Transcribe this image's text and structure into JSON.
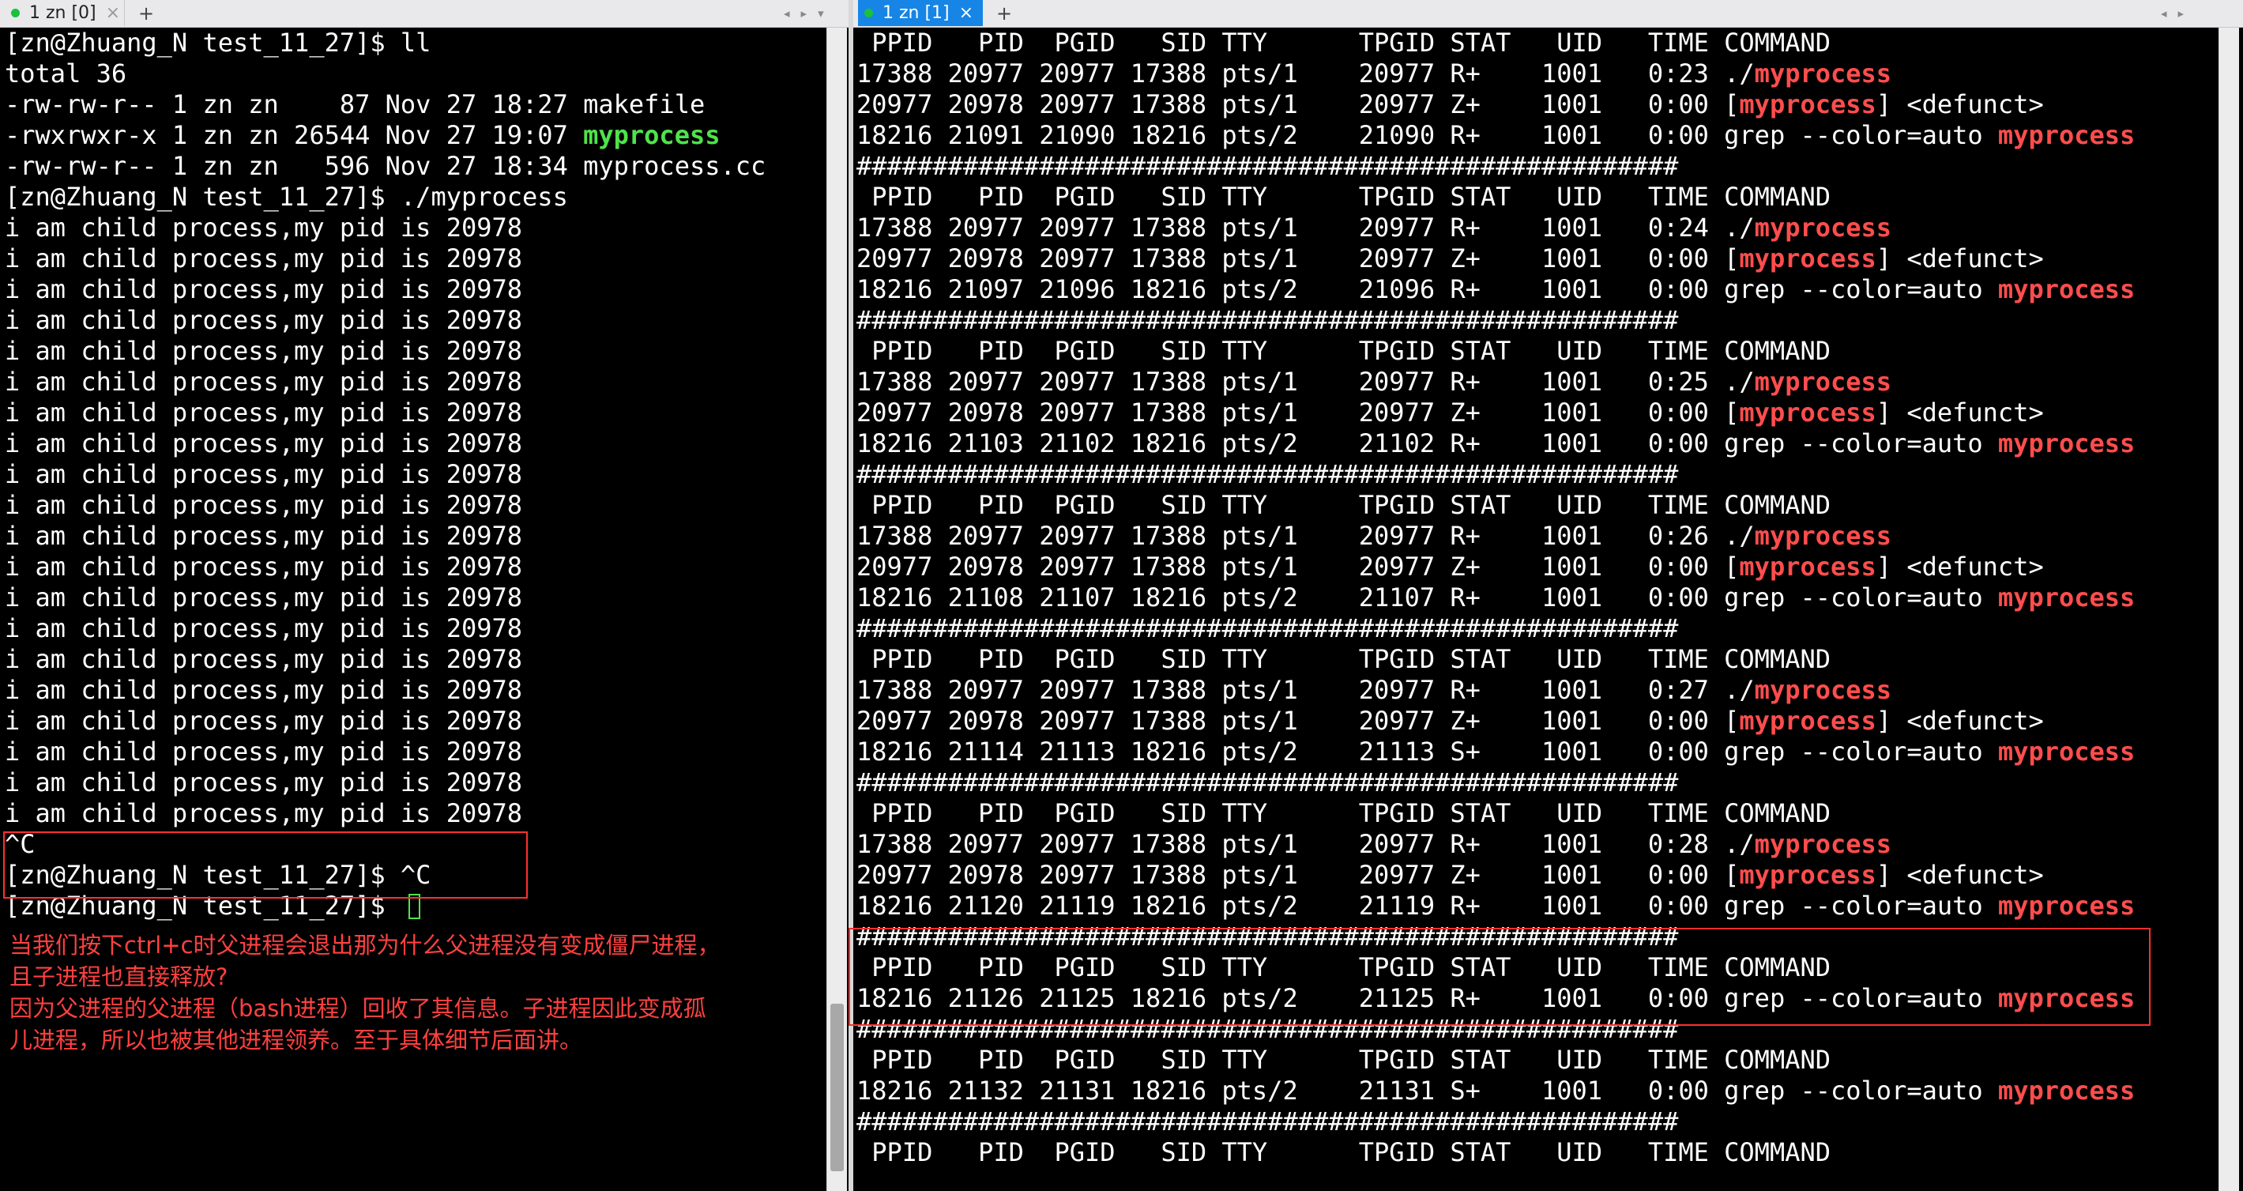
{
  "tabs": {
    "left": {
      "label": "1 zn [0]",
      "close": "×",
      "add": "+"
    },
    "right": {
      "label": "1 zn [1]",
      "close": "×",
      "add": "+"
    },
    "nav_icons": [
      "arrow-left-icon",
      "arrow-right-icon",
      "dropdown-arrow-icon"
    ]
  },
  "colors": {
    "background": "#000000",
    "text": "#ffffff",
    "executable": "#4fe34b",
    "grep_highlight": "#ff4d4d",
    "annotation": "#ff3030",
    "active_tab": "#1685e6",
    "status_dot": "#19c23a"
  },
  "left_terminal": {
    "lines": [
      [
        {
          "t": "[zn@Zhuang_N test_11_27]$ ll"
        }
      ],
      [
        {
          "t": "total 36"
        }
      ],
      [
        {
          "t": "-rw-rw-r-- 1 zn zn    87 Nov 27 18:27 makefile"
        }
      ],
      [
        {
          "t": "-rwxrwxr-x 1 zn zn 26544 Nov 27 19:07 "
        },
        {
          "t": "myprocess",
          "c": "exe"
        }
      ],
      [
        {
          "t": "-rw-rw-r-- 1 zn zn   596 Nov 27 18:34 myprocess.cc"
        }
      ],
      [
        {
          "t": "[zn@Zhuang_N test_11_27]$ ./myprocess"
        }
      ],
      [
        {
          "t": "i am child process,my pid is 20978"
        }
      ],
      [
        {
          "t": "i am child process,my pid is 20978"
        }
      ],
      [
        {
          "t": "i am child process,my pid is 20978"
        }
      ],
      [
        {
          "t": "i am child process,my pid is 20978"
        }
      ],
      [
        {
          "t": "i am child process,my pid is 20978"
        }
      ],
      [
        {
          "t": "i am child process,my pid is 20978"
        }
      ],
      [
        {
          "t": "i am child process,my pid is 20978"
        }
      ],
      [
        {
          "t": "i am child process,my pid is 20978"
        }
      ],
      [
        {
          "t": "i am child process,my pid is 20978"
        }
      ],
      [
        {
          "t": "i am child process,my pid is 20978"
        }
      ],
      [
        {
          "t": "i am child process,my pid is 20978"
        }
      ],
      [
        {
          "t": "i am child process,my pid is 20978"
        }
      ],
      [
        {
          "t": "i am child process,my pid is 20978"
        }
      ],
      [
        {
          "t": "i am child process,my pid is 20978"
        }
      ],
      [
        {
          "t": "i am child process,my pid is 20978"
        }
      ],
      [
        {
          "t": "i am child process,my pid is 20978"
        }
      ],
      [
        {
          "t": "i am child process,my pid is 20978"
        }
      ],
      [
        {
          "t": "i am child process,my pid is 20978"
        }
      ],
      [
        {
          "t": "i am child process,my pid is 20978"
        }
      ],
      [
        {
          "t": "i am child process,my pid is 20978"
        }
      ],
      [
        {
          "t": "^C"
        }
      ],
      [
        {
          "t": "[zn@Zhuang_N test_11_27]$ ^C"
        }
      ],
      [
        {
          "t": "[zn@Zhuang_N test_11_27]$ "
        },
        {
          "cursor": true
        }
      ]
    ],
    "note": [
      "当我们按下ctrl+c时父进程会退出那为什么父进程没有变成僵尸进程，",
      "且子进程也直接释放?",
      "因为父进程的父进程（bash进程）回收了其信息。子进程因此变成孤",
      "儿进程，所以也被其他进程领养。至于具体细节后面讲。"
    ]
  },
  "right_terminal": {
    "lines": [
      [
        {
          "t": " PPID   PID  PGID   SID TTY      TPGID STAT   UID   TIME COMMAND"
        }
      ],
      [
        {
          "t": "17388 20977 20977 17388 pts/1    20977 R+    1001   0:23 ./"
        },
        {
          "t": "myprocess",
          "c": "hl"
        }
      ],
      [
        {
          "t": "20977 20978 20977 17388 pts/1    20977 Z+    1001   0:00 ["
        },
        {
          "t": "myprocess",
          "c": "hl"
        },
        {
          "t": "] <defunct>"
        }
      ],
      [
        {
          "t": "18216 21091 21090 18216 pts/2    21090 R+    1001   0:00 grep --color=auto "
        },
        {
          "t": "myprocess",
          "c": "hl"
        }
      ],
      [
        {
          "t": "######################################################"
        }
      ],
      [
        {
          "t": " PPID   PID  PGID   SID TTY      TPGID STAT   UID   TIME COMMAND"
        }
      ],
      [
        {
          "t": "17388 20977 20977 17388 pts/1    20977 R+    1001   0:24 ./"
        },
        {
          "t": "myprocess",
          "c": "hl"
        }
      ],
      [
        {
          "t": "20977 20978 20977 17388 pts/1    20977 Z+    1001   0:00 ["
        },
        {
          "t": "myprocess",
          "c": "hl"
        },
        {
          "t": "] <defunct>"
        }
      ],
      [
        {
          "t": "18216 21097 21096 18216 pts/2    21096 R+    1001   0:00 grep --color=auto "
        },
        {
          "t": "myprocess",
          "c": "hl"
        }
      ],
      [
        {
          "t": "######################################################"
        }
      ],
      [
        {
          "t": " PPID   PID  PGID   SID TTY      TPGID STAT   UID   TIME COMMAND"
        }
      ],
      [
        {
          "t": "17388 20977 20977 17388 pts/1    20977 R+    1001   0:25 ./"
        },
        {
          "t": "myprocess",
          "c": "hl"
        }
      ],
      [
        {
          "t": "20977 20978 20977 17388 pts/1    20977 Z+    1001   0:00 ["
        },
        {
          "t": "myprocess",
          "c": "hl"
        },
        {
          "t": "] <defunct>"
        }
      ],
      [
        {
          "t": "18216 21103 21102 18216 pts/2    21102 R+    1001   0:00 grep --color=auto "
        },
        {
          "t": "myprocess",
          "c": "hl"
        }
      ],
      [
        {
          "t": "######################################################"
        }
      ],
      [
        {
          "t": " PPID   PID  PGID   SID TTY      TPGID STAT   UID   TIME COMMAND"
        }
      ],
      [
        {
          "t": "17388 20977 20977 17388 pts/1    20977 R+    1001   0:26 ./"
        },
        {
          "t": "myprocess",
          "c": "hl"
        }
      ],
      [
        {
          "t": "20977 20978 20977 17388 pts/1    20977 Z+    1001   0:00 ["
        },
        {
          "t": "myprocess",
          "c": "hl"
        },
        {
          "t": "] <defunct>"
        }
      ],
      [
        {
          "t": "18216 21108 21107 18216 pts/2    21107 R+    1001   0:00 grep --color=auto "
        },
        {
          "t": "myprocess",
          "c": "hl"
        }
      ],
      [
        {
          "t": "######################################################"
        }
      ],
      [
        {
          "t": " PPID   PID  PGID   SID TTY      TPGID STAT   UID   TIME COMMAND"
        }
      ],
      [
        {
          "t": "17388 20977 20977 17388 pts/1    20977 R+    1001   0:27 ./"
        },
        {
          "t": "myprocess",
          "c": "hl"
        }
      ],
      [
        {
          "t": "20977 20978 20977 17388 pts/1    20977 Z+    1001   0:00 ["
        },
        {
          "t": "myprocess",
          "c": "hl"
        },
        {
          "t": "] <defunct>"
        }
      ],
      [
        {
          "t": "18216 21114 21113 18216 pts/2    21113 S+    1001   0:00 grep --color=auto "
        },
        {
          "t": "myprocess",
          "c": "hl"
        }
      ],
      [
        {
          "t": "######################################################"
        }
      ],
      [
        {
          "t": " PPID   PID  PGID   SID TTY      TPGID STAT   UID   TIME COMMAND"
        }
      ],
      [
        {
          "t": "17388 20977 20977 17388 pts/1    20977 R+    1001   0:28 ./"
        },
        {
          "t": "myprocess",
          "c": "hl"
        }
      ],
      [
        {
          "t": "20977 20978 20977 17388 pts/1    20977 Z+    1001   0:00 ["
        },
        {
          "t": "myprocess",
          "c": "hl"
        },
        {
          "t": "] <defunct>"
        }
      ],
      [
        {
          "t": "18216 21120 21119 18216 pts/2    21119 R+    1001   0:00 grep --color=auto "
        },
        {
          "t": "myprocess",
          "c": "hl"
        }
      ],
      [
        {
          "t": "######################################################"
        }
      ],
      [
        {
          "t": " PPID   PID  PGID   SID TTY      TPGID STAT   UID   TIME COMMAND"
        }
      ],
      [
        {
          "t": "18216 21126 21125 18216 pts/2    21125 R+    1001   0:00 grep --color=auto "
        },
        {
          "t": "myprocess",
          "c": "hl"
        }
      ],
      [
        {
          "t": "######################################################"
        }
      ],
      [
        {
          "t": " PPID   PID  PGID   SID TTY      TPGID STAT   UID   TIME COMMAND"
        }
      ],
      [
        {
          "t": "18216 21132 21131 18216 pts/2    21131 S+    1001   0:00 grep --color=auto "
        },
        {
          "t": "myprocess",
          "c": "hl"
        }
      ],
      [
        {
          "t": "######################################################"
        }
      ],
      [
        {
          "t": " PPID   PID  PGID   SID TTY      TPGID STAT   UID   TIME COMMAND"
        }
      ]
    ]
  }
}
